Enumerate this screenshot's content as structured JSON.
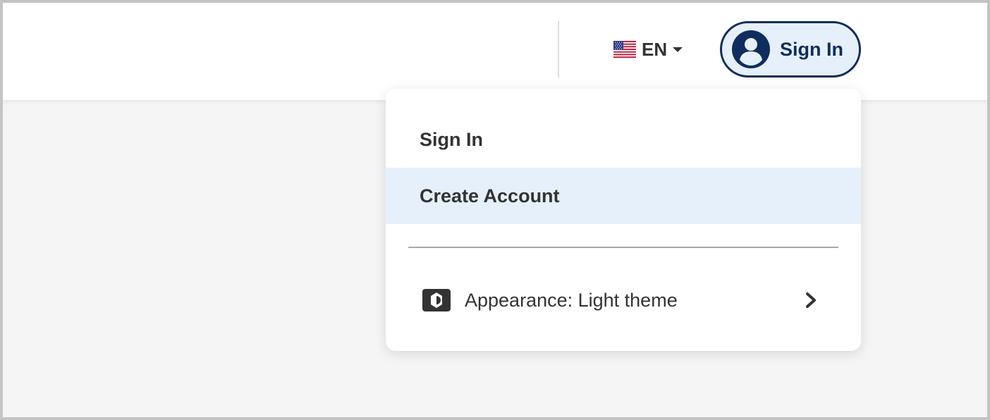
{
  "header": {
    "language": {
      "code": "EN",
      "flag_icon": "us-flag-icon"
    },
    "sign_in_button": {
      "label": "Sign In",
      "icon": "user-avatar-icon"
    }
  },
  "menu": {
    "items": [
      {
        "label": "Sign In"
      },
      {
        "label": "Create Account",
        "highlighted": true
      }
    ],
    "appearance": {
      "label": "Appearance: Light theme",
      "icon": "brightness-icon",
      "trailing_icon": "chevron-right-icon"
    }
  },
  "colors": {
    "navy": "#0f2d5e",
    "highlight": "#e6f0fb",
    "text": "#333333",
    "page_bg": "#f5f5f5"
  }
}
